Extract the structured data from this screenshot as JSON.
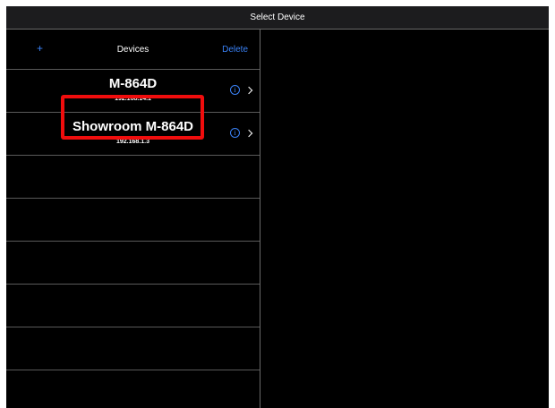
{
  "window": {
    "title": "Select Device"
  },
  "navbar": {
    "add_label": "+",
    "title": "Devices",
    "delete_label": "Delete"
  },
  "devices": [
    {
      "name": "M-864D",
      "ip": "192.168.14.1",
      "highlighted": true
    },
    {
      "name": "Showroom M-864D",
      "ip": "192.168.1.3",
      "highlighted": false
    }
  ],
  "icons": {
    "info": "info-circle-icon",
    "disclosure": "chevron-right-icon"
  },
  "info_glyph": "i",
  "colors": {
    "background": "#000000",
    "accent": "#3a82f7",
    "separator": "#5a5a5a",
    "highlight": "#f00d0d"
  }
}
